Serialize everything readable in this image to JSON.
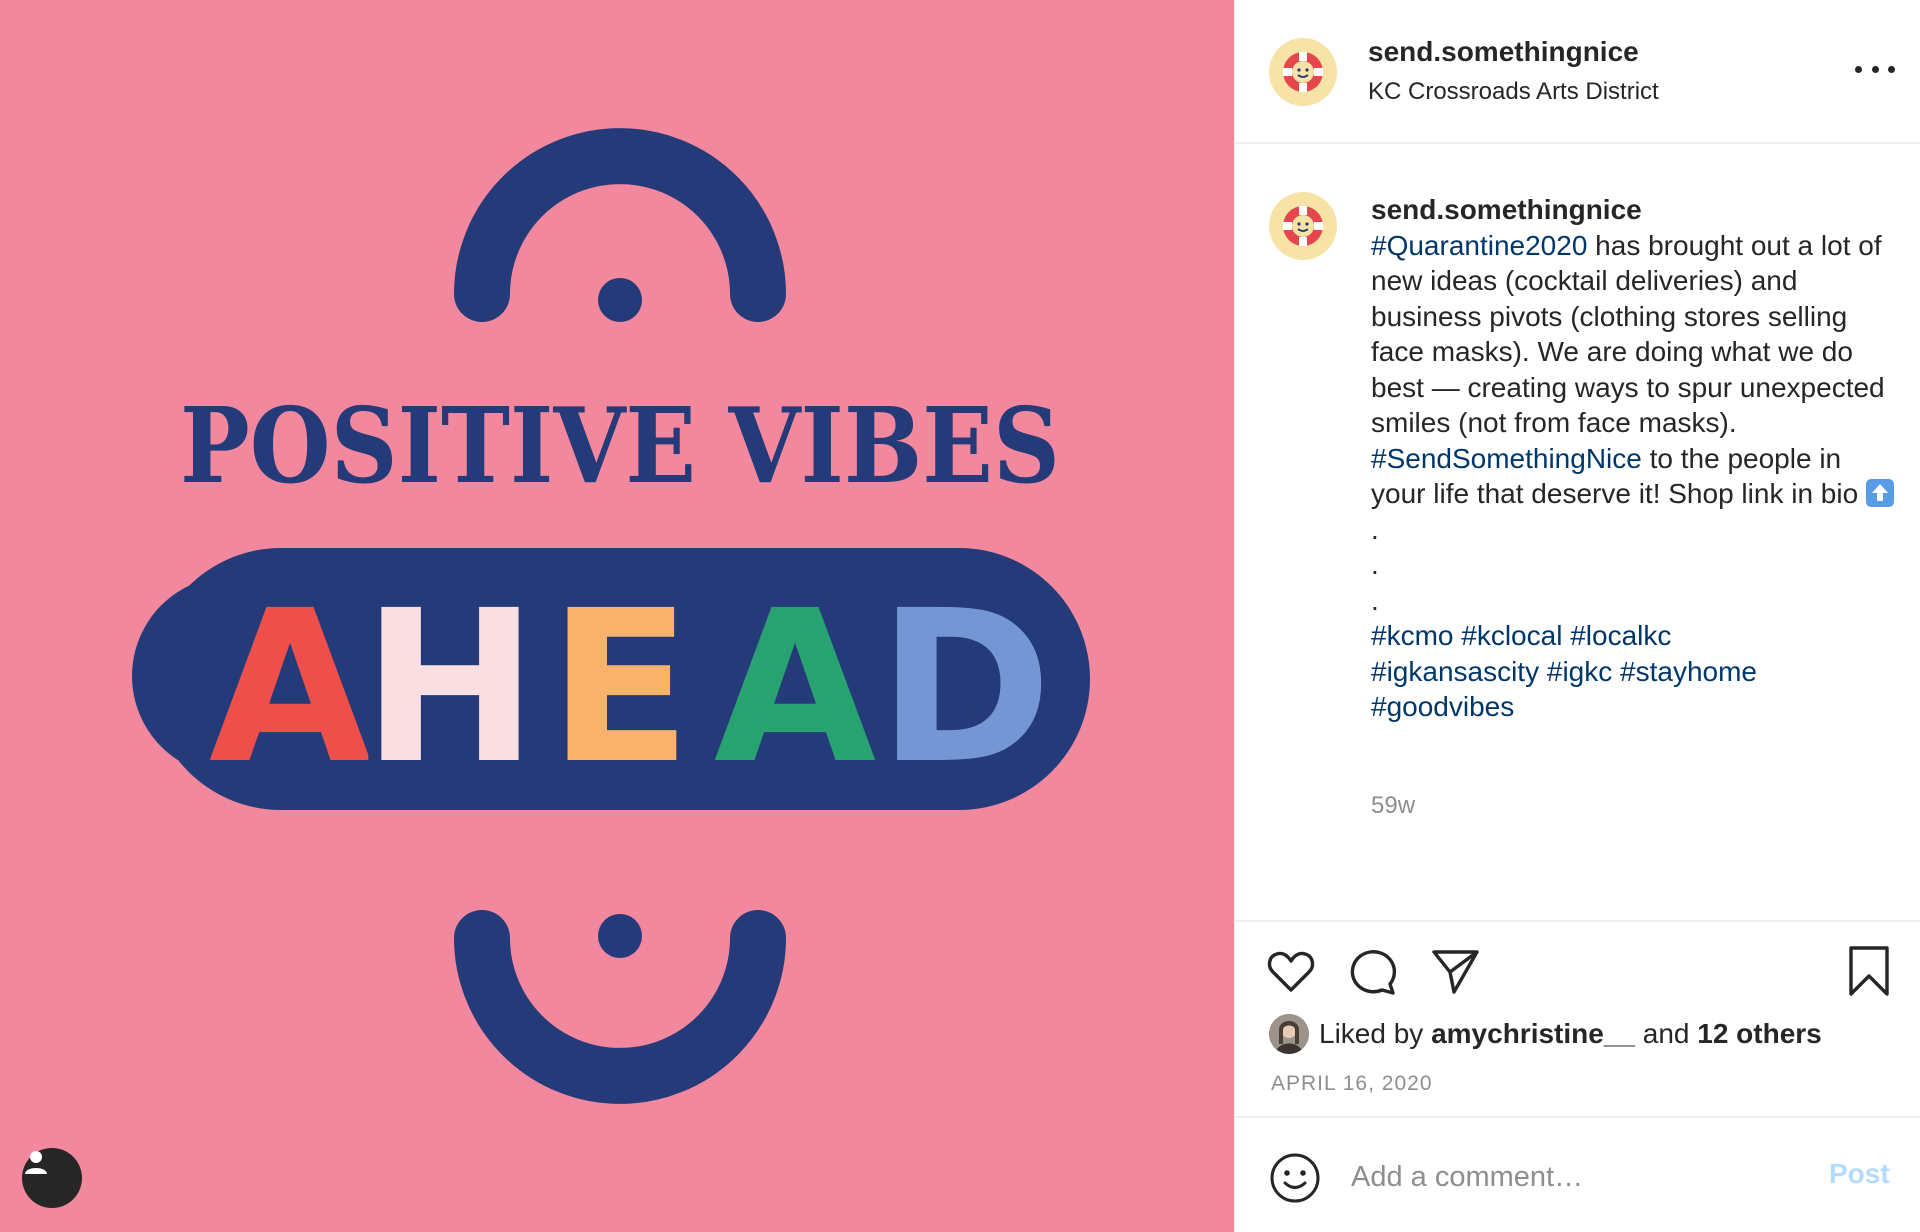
{
  "post": {
    "image": {
      "background_color": "#f2889e",
      "navy": "#253a78",
      "headline": "POSITIVE VIBES",
      "word_letters": [
        {
          "char": "A",
          "color": "#ee4f4b"
        },
        {
          "char": "H",
          "color": "#fbe0e3"
        },
        {
          "char": "E",
          "color": "#f9b26b"
        },
        {
          "char": "A",
          "color": "#27a270"
        },
        {
          "char": "D",
          "color": "#7496d4"
        }
      ]
    },
    "tag_button_icon": "user-tag-icon"
  },
  "header": {
    "username": "send.somethingnice",
    "location": "KC Crossroads Arts District",
    "avatar_icon": "life-ring-smiley-icon",
    "more_icon": "more-options-icon"
  },
  "caption": {
    "username": "send.somethingnice",
    "tag1": "#Quarantine2020",
    "text1": " has brought out a lot of new ideas (cocktail deliveries) and business pivots (clothing stores selling face masks). We are doing what we do best — creating ways to spur unexpected smiles (not from face masks). ",
    "tag2": "#SendSomethingNice",
    "text2": " to the people in your life that deserve it! Shop link in bio ",
    "emoji": "up-arrow-emoji",
    "dot1": ".",
    "dot2": ".",
    "dot3": ".",
    "hashtags": [
      "#kcmo",
      "#kclocal",
      "#localkc",
      "#igkansascity",
      "#igkc",
      "#stayhome",
      "#goodvibes"
    ],
    "time_ago": "59w"
  },
  "actions": {
    "like_icon": "heart-icon",
    "comment_icon": "comment-icon",
    "share_icon": "share-icon",
    "save_icon": "bookmark-icon"
  },
  "likes": {
    "prefix": "Liked by ",
    "user": "amychristine__",
    "middle": " and ",
    "others": "12 others"
  },
  "date": "APRIL 16, 2020",
  "comment": {
    "placeholder": "Add a comment…",
    "post_label": "Post",
    "emoji_icon": "emoji-smiley-icon"
  },
  "colors": {
    "hashtag": "#00376b",
    "muted": "#8e8e8e",
    "post_disabled": "#b3dbff"
  }
}
